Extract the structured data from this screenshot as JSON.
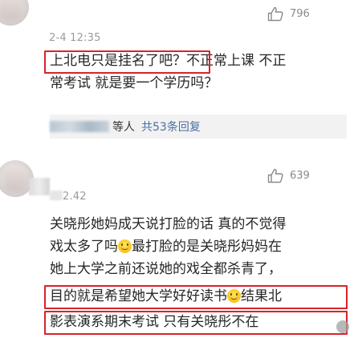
{
  "comments": [
    {
      "timestamp": "2-4 12:35",
      "likes": "796",
      "lines": [
        "上北电只是挂名了吧？不正常上课 不正",
        "常考试 就是要一个学历吗？"
      ],
      "highlight_text": "上北电只是挂名了吧？",
      "reply_suffix": "等人",
      "reply_link": "共53条回复"
    },
    {
      "timestamp": "2.42",
      "likes": "639",
      "lines": [
        "关晓彤她妈成天说打脸的话 真的不觉得",
        "戏太多了吗",
        "最打脸的是关晓彤妈妈在",
        "她上大学之前还说她的戏全都杀青了，",
        "目的就是希望她大学好好读书",
        "结果北",
        "影表演系期末考试 只有关晓彤不在"
      ]
    }
  ],
  "icons": {
    "like": "thumbs-up-icon",
    "emoji": "smile-emoji-icon",
    "watermark": "watermark-logo-icon"
  },
  "colors": {
    "highlight": "#d8232a",
    "link": "#4a6fa0"
  }
}
